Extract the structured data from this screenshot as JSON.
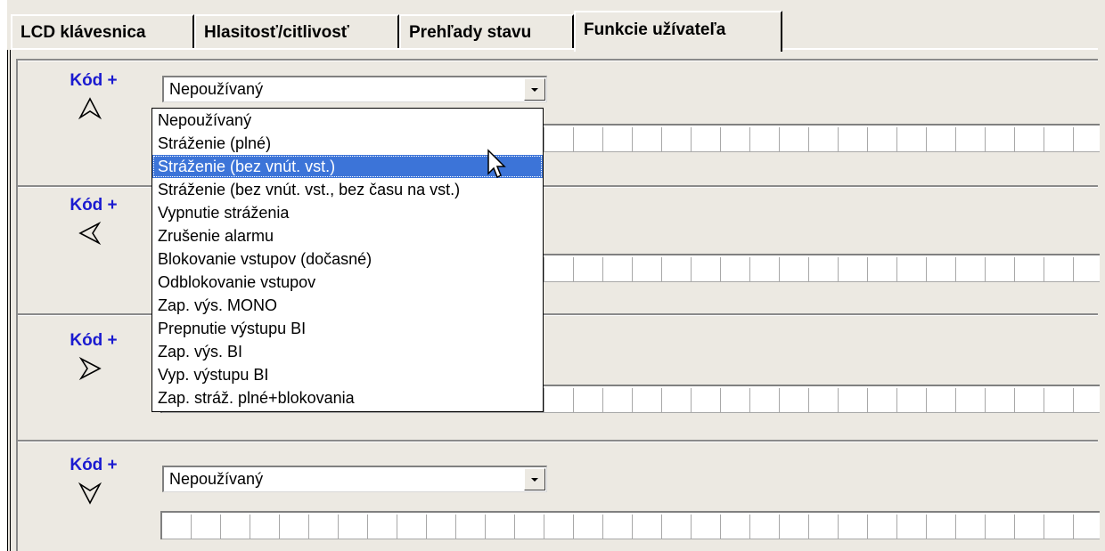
{
  "tabs": [
    {
      "label": "LCD klávesnica",
      "active": false
    },
    {
      "label": "Hlasitosť/citlivosť",
      "active": false
    },
    {
      "label": "Prehľady stavu",
      "active": false
    },
    {
      "label": "Funkcie užívateľa",
      "active": true
    }
  ],
  "rows": [
    {
      "label": "Kód +",
      "arrow": "up-arrow-icon",
      "selected": "Nepoužívaný"
    },
    {
      "label": "Kód +",
      "arrow": "left-arrow-icon",
      "selected": ""
    },
    {
      "label": "Kód +",
      "arrow": "right-arrow-icon",
      "selected": ""
    },
    {
      "label": "Kód +",
      "arrow": "down-arrow-icon",
      "selected": "Nepoužívaný"
    }
  ],
  "dropdown": {
    "highlighted_index": 2,
    "options": [
      "Nepoužívaný",
      "Stráženie (plné)",
      "Stráženie (bez vnút. vst.)",
      "Stráženie (bez vnút. vst., bez času na vst.)",
      "Vypnutie stráženia",
      "Zrušenie alarmu",
      "Blokovanie vstupov (dočasné)",
      "Odblokovanie vstupov",
      "Zap. výs. MONO",
      "Prepnutie výstupu BI",
      "Zap. výs. BI",
      "Vyp. výstupu BI",
      "Zap. stráž. plné+blokovania"
    ]
  },
  "colors": {
    "label_blue": "#1a1ad0",
    "highlight": "#3c74d8",
    "panel": "#ece9e2"
  }
}
